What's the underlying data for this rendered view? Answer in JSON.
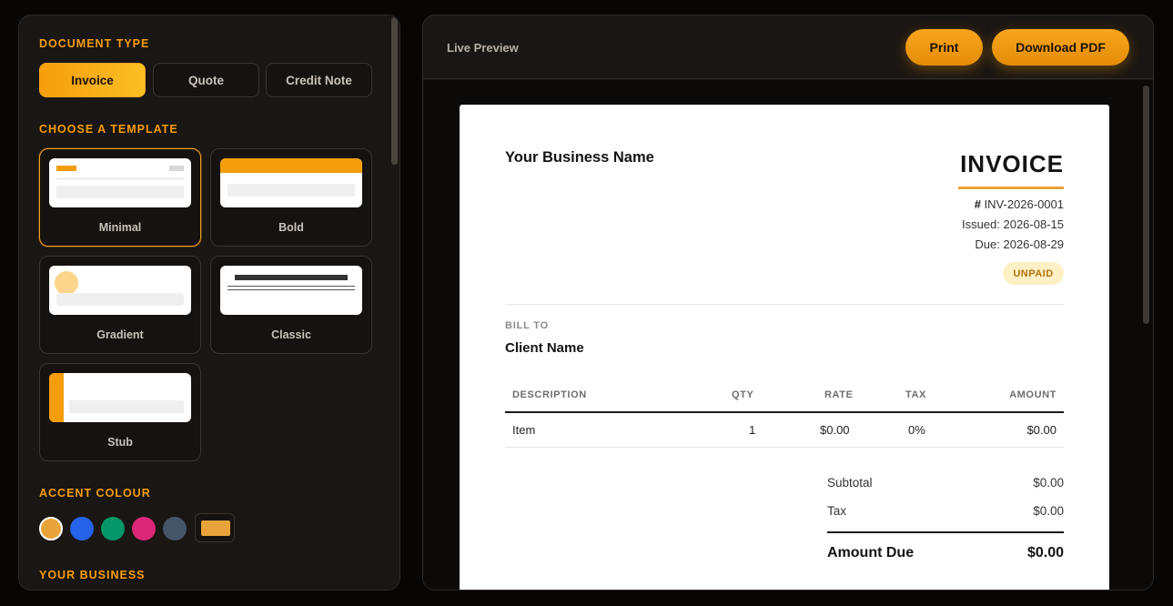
{
  "sidebar": {
    "document_type_label": "DOCUMENT TYPE",
    "doc_types": [
      "Invoice",
      "Quote",
      "Credit Note"
    ],
    "template_label": "CHOOSE A TEMPLATE",
    "templates": [
      "Minimal",
      "Bold",
      "Gradient",
      "Classic",
      "Stub"
    ],
    "accent_label": "ACCENT COLOUR",
    "accent_colors": [
      "#e8a33a",
      "#2563eb",
      "#059669",
      "#db2777",
      "#475569"
    ],
    "custom_color": "#e8a33a",
    "business_label": "YOUR BUSINESS"
  },
  "preview": {
    "label": "Live Preview",
    "print_label": "Print",
    "download_label": "Download PDF"
  },
  "invoice": {
    "business_name": "Your Business Name",
    "title": "INVOICE",
    "number_prefix": "#",
    "number": "INV-2026-0001",
    "issued": "Issued: 2026-08-15",
    "due": "Due: 2026-08-29",
    "status": "UNPAID",
    "bill_to_label": "BILL TO",
    "client_name": "Client Name",
    "columns": [
      "DESCRIPTION",
      "QTY",
      "RATE",
      "TAX",
      "AMOUNT"
    ],
    "items": [
      {
        "description": "Item",
        "qty": "1",
        "rate": "$0.00",
        "tax": "0%",
        "amount": "$0.00"
      }
    ],
    "subtotal_label": "Subtotal",
    "subtotal": "$0.00",
    "tax_label": "Tax",
    "tax": "$0.00",
    "amount_due_label": "Amount Due",
    "amount_due": "$0.00"
  }
}
